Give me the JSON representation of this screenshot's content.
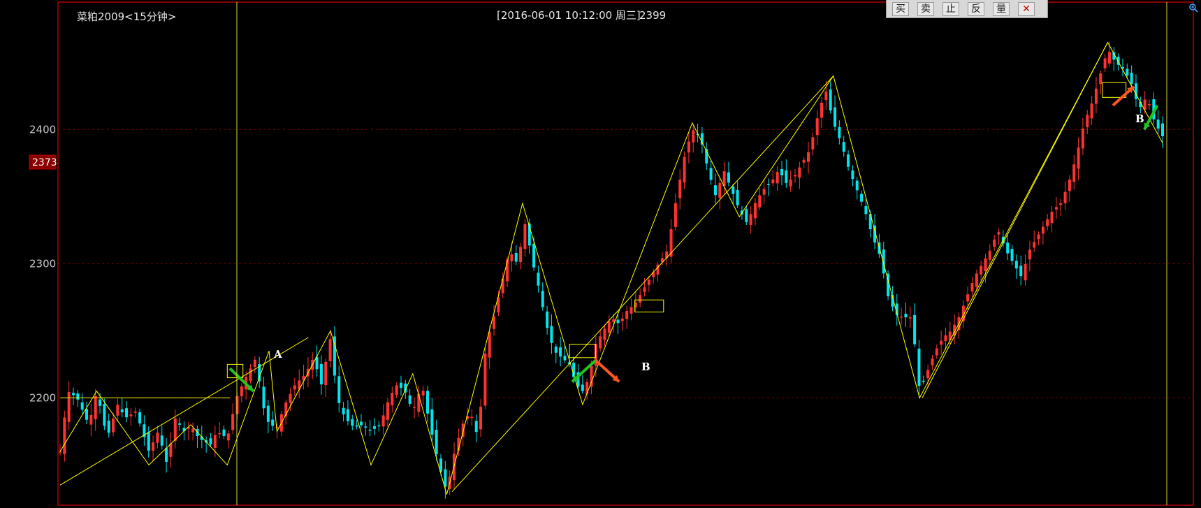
{
  "header": {
    "symbol": "菜粕2009<15分钟>",
    "datetime": "[2016-06-01  10:12:00 周三]",
    "price": "2399"
  },
  "toolbar": {
    "buttons": [
      "买",
      "卖",
      "止",
      "反",
      "量"
    ],
    "close_label": "✕"
  },
  "current_price_tag": "2373",
  "colors": {
    "up": "#ff3232",
    "down": "#00e5ee",
    "zigzag": "#ffff00",
    "frame": "#b40000",
    "grid": "#7a0000",
    "arrow_green": "#22c422",
    "arrow_red": "#ff5522"
  },
  "chart_data": {
    "type": "candlestick",
    "ylim": [
      2120,
      2495
    ],
    "y_ticks": [
      2200,
      2300,
      2400
    ],
    "grid": "horizontal dotted",
    "annotations": [
      "A",
      "B",
      "B"
    ],
    "price_path": [
      [
        0,
        2160
      ],
      [
        6,
        2205
      ],
      [
        13,
        2200
      ],
      [
        22,
        2180
      ],
      [
        28,
        2205
      ],
      [
        36,
        2170
      ],
      [
        44,
        2195
      ],
      [
        50,
        2185
      ],
      [
        58,
        2190
      ],
      [
        62,
        2178
      ],
      [
        68,
        2160
      ],
      [
        75,
        2175
      ],
      [
        82,
        2150
      ],
      [
        88,
        2185
      ],
      [
        95,
        2175
      ],
      [
        100,
        2180
      ],
      [
        106,
        2170
      ],
      [
        115,
        2165
      ],
      [
        120,
        2175
      ],
      [
        128,
        2170
      ],
      [
        135,
        2200
      ],
      [
        142,
        2215
      ],
      [
        150,
        2230
      ],
      [
        155,
        2195
      ],
      [
        160,
        2180
      ],
      [
        166,
        2178
      ],
      [
        172,
        2195
      ],
      [
        180,
        2210
      ],
      [
        188,
        2218
      ],
      [
        194,
        2230
      ],
      [
        200,
        2210
      ],
      [
        207,
        2245
      ],
      [
        212,
        2200
      ],
      [
        218,
        2185
      ],
      [
        225,
        2178
      ],
      [
        232,
        2180
      ],
      [
        238,
        2175
      ],
      [
        245,
        2180
      ],
      [
        252,
        2200
      ],
      [
        258,
        2210
      ],
      [
        264,
        2205
      ],
      [
        270,
        2190
      ],
      [
        277,
        2210
      ],
      [
        283,
        2180
      ],
      [
        290,
        2150
      ],
      [
        296,
        2130
      ],
      [
        302,
        2160
      ],
      [
        308,
        2180
      ],
      [
        314,
        2190
      ],
      [
        320,
        2170
      ],
      [
        326,
        2240
      ],
      [
        332,
        2260
      ],
      [
        338,
        2285
      ],
      [
        344,
        2310
      ],
      [
        350,
        2300
      ],
      [
        356,
        2330
      ],
      [
        362,
        2300
      ],
      [
        367,
        2280
      ],
      [
        372,
        2255
      ],
      [
        378,
        2235
      ],
      [
        384,
        2230
      ],
      [
        390,
        2225
      ],
      [
        395,
        2210
      ],
      [
        400,
        2205
      ],
      [
        405,
        2215
      ],
      [
        410,
        2240
      ],
      [
        416,
        2250
      ],
      [
        422,
        2260
      ],
      [
        428,
        2255
      ],
      [
        434,
        2265
      ],
      [
        440,
        2270
      ],
      [
        446,
        2280
      ],
      [
        452,
        2290
      ],
      [
        458,
        2300
      ],
      [
        465,
        2310
      ],
      [
        472,
        2350
      ],
      [
        478,
        2380
      ],
      [
        484,
        2400
      ],
      [
        490,
        2395
      ],
      [
        496,
        2370
      ],
      [
        502,
        2350
      ],
      [
        508,
        2370
      ],
      [
        514,
        2355
      ],
      [
        520,
        2340
      ],
      [
        526,
        2330
      ],
      [
        532,
        2345
      ],
      [
        538,
        2355
      ],
      [
        544,
        2360
      ],
      [
        550,
        2370
      ],
      [
        556,
        2360
      ],
      [
        562,
        2365
      ],
      [
        568,
        2375
      ],
      [
        574,
        2385
      ],
      [
        580,
        2410
      ],
      [
        586,
        2430
      ],
      [
        592,
        2405
      ],
      [
        598,
        2390
      ],
      [
        604,
        2370
      ],
      [
        610,
        2355
      ],
      [
        616,
        2340
      ],
      [
        622,
        2320
      ],
      [
        628,
        2305
      ],
      [
        634,
        2275
      ],
      [
        640,
        2262
      ],
      [
        646,
        2260
      ],
      [
        652,
        2260
      ],
      [
        658,
        2205
      ],
      [
        664,
        2220
      ],
      [
        670,
        2235
      ],
      [
        676,
        2245
      ],
      [
        682,
        2250
      ],
      [
        688,
        2260
      ],
      [
        694,
        2275
      ],
      [
        700,
        2290
      ],
      [
        706,
        2300
      ],
      [
        712,
        2310
      ],
      [
        718,
        2325
      ],
      [
        724,
        2310
      ],
      [
        730,
        2300
      ],
      [
        736,
        2290
      ],
      [
        742,
        2310
      ],
      [
        748,
        2320
      ],
      [
        754,
        2330
      ],
      [
        760,
        2340
      ],
      [
        766,
        2345
      ],
      [
        772,
        2360
      ],
      [
        778,
        2380
      ],
      [
        784,
        2405
      ],
      [
        790,
        2420
      ],
      [
        796,
        2440
      ],
      [
        802,
        2460
      ],
      [
        808,
        2450
      ],
      [
        814,
        2445
      ],
      [
        820,
        2435
      ],
      [
        826,
        2415
      ],
      [
        832,
        2425
      ],
      [
        838,
        2405
      ],
      [
        844,
        2395
      ]
    ]
  }
}
